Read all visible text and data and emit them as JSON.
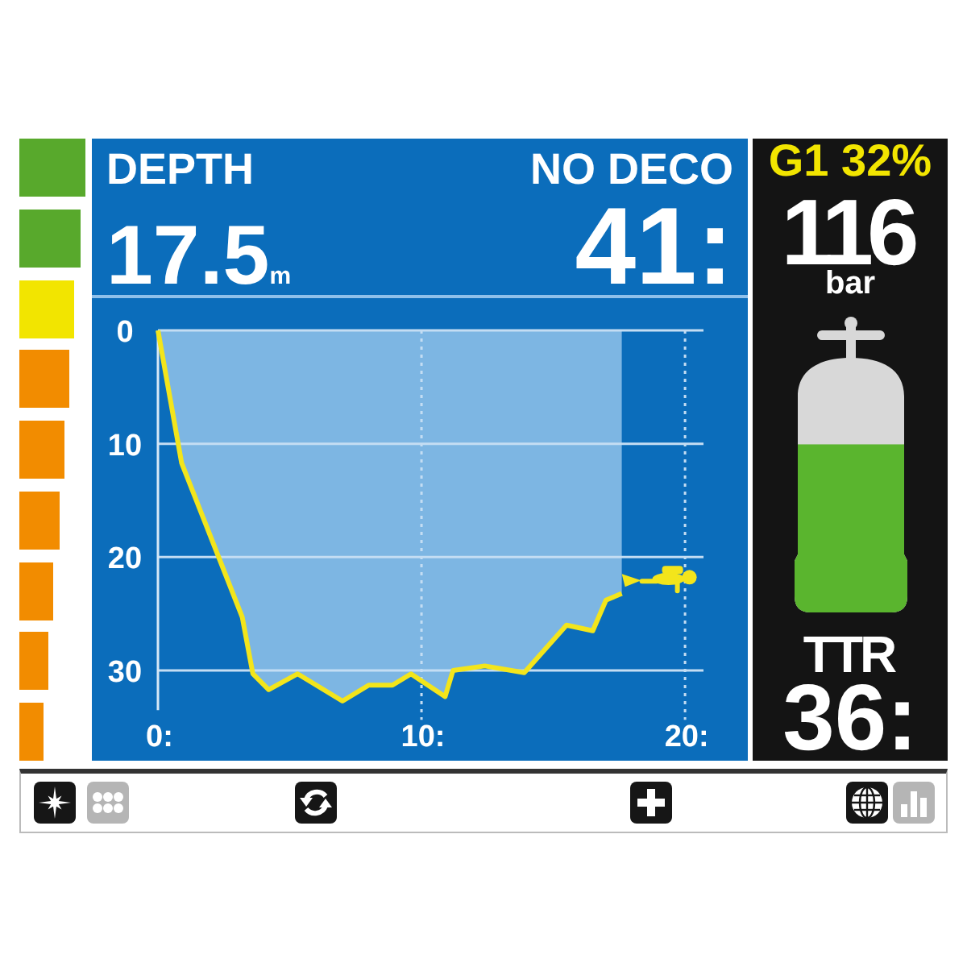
{
  "gauge": {
    "segments": [
      {
        "color": "#58a92c"
      },
      {
        "color": "#58a92c"
      },
      {
        "color": "#f2e500"
      },
      {
        "color": "#f28c00"
      },
      {
        "color": "#f28c00"
      },
      {
        "color": "#f28c00"
      },
      {
        "color": "#f28c00"
      },
      {
        "color": "#f28c00"
      },
      {
        "color": "#f28c00"
      }
    ]
  },
  "depth": {
    "label": "DEPTH",
    "value": "17.5",
    "unit": "m"
  },
  "no_deco": {
    "label": "NO DECO",
    "value": "41:"
  },
  "depth_profile": {
    "chart_data": {
      "type": "area",
      "x": [
        0,
        0.9,
        3.2,
        3.6,
        4.2,
        5.3,
        7.0,
        8.0,
        8.9,
        9.6,
        10.9,
        11.2,
        12.4,
        13.9,
        15.5,
        16.5,
        17.0,
        17.6
      ],
      "series": [
        {
          "values": [
            0,
            11.7,
            25.3,
            30.3,
            31.7,
            30.3,
            32.7,
            31.3,
            31.3,
            30.3,
            32.3,
            30,
            29.6,
            30.2,
            26,
            26.5,
            23.8,
            23.2
          ]
        }
      ],
      "xlim": [
        0,
        20.7
      ],
      "ylim": [
        33.5,
        0
      ],
      "xticks": [
        {
          "value": 0,
          "label": "0:"
        },
        {
          "value": 10,
          "label": "10:"
        },
        {
          "value": 20,
          "label": "20:"
        }
      ],
      "yticks": [
        0,
        10,
        20,
        30
      ],
      "grid": true
    }
  },
  "gas": {
    "label": "G1 32%",
    "pressure": "116",
    "unit": "bar",
    "tank": {
      "level": 0.66
    },
    "ttr": {
      "label": "TTR",
      "value": "36:"
    }
  },
  "soft_keys": [
    {
      "disabled": false
    },
    {
      "disabled": true
    },
    {
      "disabled": false
    },
    {
      "disabled": false
    },
    {
      "disabled": false
    },
    {
      "disabled": true
    }
  ]
}
